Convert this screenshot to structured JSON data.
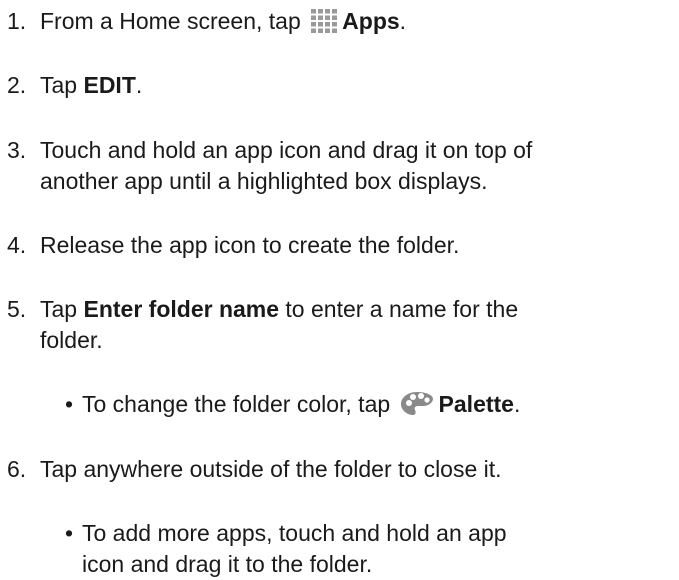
{
  "steps": [
    {
      "num": "1.",
      "pre": "From a Home screen, tap ",
      "icon": "apps-grid-icon",
      "bold": "Apps",
      "post": "."
    },
    {
      "num": "2.",
      "pre": "Tap ",
      "bold": "EDIT",
      "post": "."
    },
    {
      "num": "3.",
      "line1": "Touch and hold an app icon and drag it on top of",
      "line2": "another app until a highlighted box displays."
    },
    {
      "num": "4.",
      "text": "Release the app icon to create the folder."
    },
    {
      "num": "5.",
      "pre": "Tap ",
      "bold": "Enter folder name",
      "post": " to enter a name for the",
      "line2": "folder."
    },
    {
      "num": "6.",
      "text": "Tap anywhere outside of the folder to close it."
    }
  ],
  "bullets": [
    {
      "mark": "•",
      "pre": "To change the folder color, tap ",
      "icon": "palette-icon",
      "bold": "Palette",
      "post": "."
    },
    {
      "mark": "•",
      "line1": "To add more apps, touch and hold an app",
      "line2": "icon and drag it to the folder."
    }
  ]
}
